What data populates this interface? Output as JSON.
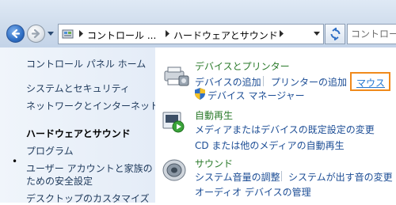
{
  "address_bar": {
    "crumbs": [
      "コントロール ...",
      "ハードウェアとサウンド"
    ],
    "search_placeholder": "コントロー"
  },
  "left_nav": {
    "items": [
      {
        "label": "コントロール パネル ホーム"
      },
      {
        "label": "システムとセキュリティ"
      },
      {
        "label": "ネットワークとインターネット"
      },
      {
        "label": "ハードウェアとサウンド",
        "current": true
      },
      {
        "label": "プログラム"
      },
      {
        "label": "ユーザー アカウントと家族の"
      },
      {
        "label": "ための安全設定"
      },
      {
        "label": "デスクトップのカスタマイズ"
      }
    ],
    "current_bullet": "•"
  },
  "categories": [
    {
      "title": "デバイスとプリンター",
      "icon": "devices-printers-icon",
      "links": [
        "デバイスの追加",
        "プリンターの追加",
        "マウス",
        "デバイス マネージャー"
      ]
    },
    {
      "title": "自動再生",
      "icon": "autoplay-icon",
      "links": [
        "メディアまたはデバイスの既定設定の変更",
        "CD または他のメディアの自動再生"
      ]
    },
    {
      "title": "サウンド",
      "icon": "speaker-icon",
      "links": [
        "システム音量の調整",
        "システムが出す音の変更",
        "オーディオ デバイスの管理"
      ]
    }
  ],
  "colors": {
    "category_title": "#2a7a2a",
    "link": "#1c4d95",
    "highlight": "#f08a1c"
  }
}
